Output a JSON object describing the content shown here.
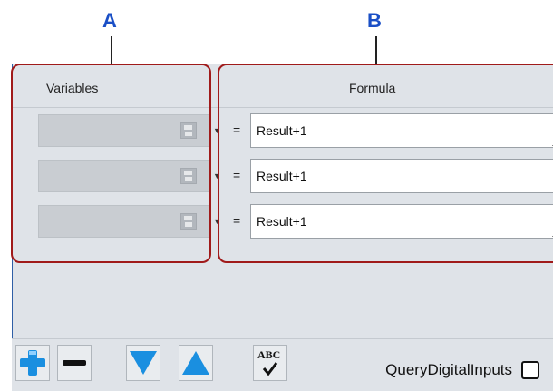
{
  "callouts": {
    "a": "A",
    "b": "B"
  },
  "header": {
    "variables": "Variables",
    "formula": "Formula"
  },
  "rows": [
    {
      "equals": "=",
      "formula": "Result+1"
    },
    {
      "equals": "=",
      "formula": "Result+1"
    },
    {
      "equals": "=",
      "formula": "Result+1"
    }
  ],
  "toolbar": {
    "buttons": [
      "add-icon",
      "remove-icon",
      "move-down-icon",
      "move-up-icon",
      "spellcheck-icon"
    ],
    "spell_text": "ABC",
    "query_label": "QueryDigitalInputs",
    "query_checked": false
  },
  "colors": {
    "accent_blue": "#1a8fe0",
    "region_red": "#a01a1a",
    "callout_blue": "#1a4fc6"
  }
}
